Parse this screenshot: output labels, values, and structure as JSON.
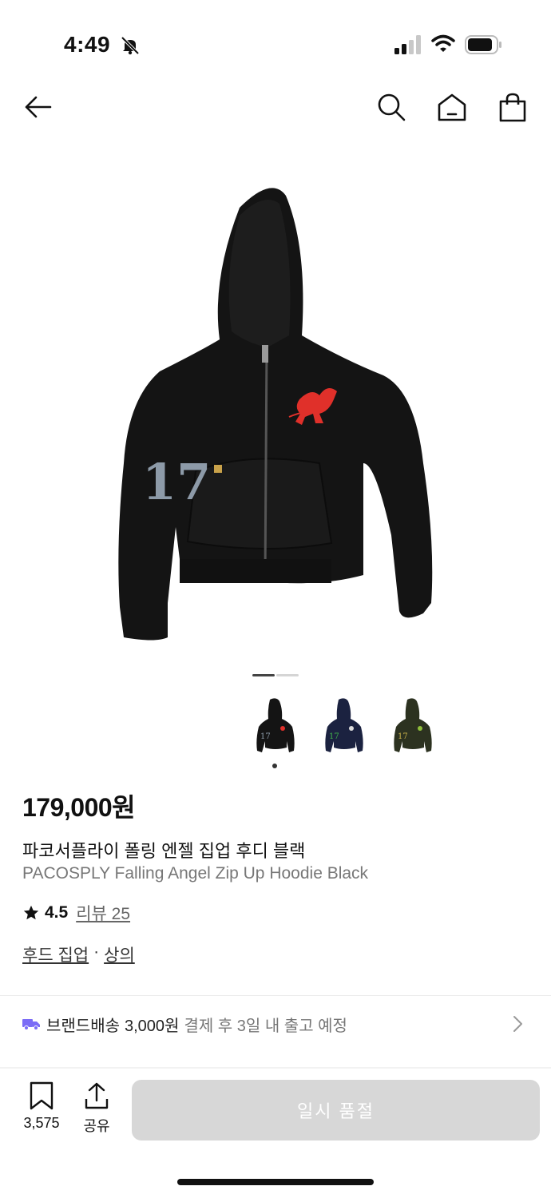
{
  "status_bar": {
    "time": "4:49"
  },
  "icons": {
    "back": "arrow-left-icon",
    "search": "search-icon",
    "home": "home-icon",
    "bag": "shopping-bag-icon",
    "bell_off": "bell-off-icon",
    "bookmark": "bookmark-icon",
    "share": "share-icon",
    "truck": "truck-icon",
    "chevron": "chevron-right-icon",
    "star": "star-icon"
  },
  "gallery": {
    "current_page": 1,
    "total_pages": 2,
    "thumbnails": [
      "black",
      "navy",
      "olive"
    ],
    "selected_thumbnail": 1
  },
  "product": {
    "price": "179,000원",
    "title_ko": "파코서플라이 폴링 엔젤 집업 후디 블랙",
    "title_en": "PACOSPLY Falling Angel Zip Up Hoodie Black",
    "rating": "4.5",
    "review_label": "리뷰 25",
    "category_primary": "후드 집업",
    "category_separator": "·",
    "category_secondary": "상의"
  },
  "shipping": {
    "brand_label": "브랜드배송",
    "price": "3,000원",
    "desc": "결제 후 3일 내 출고 예정"
  },
  "bottom_bar": {
    "bookmark_count": "3,575",
    "share_label": "공유",
    "soldout_label": "일시 품절"
  },
  "colors": {
    "accent_truck": "#7b6cf6",
    "soldout_bg": "#d7d7d7",
    "logo_red": "#e0302a"
  }
}
